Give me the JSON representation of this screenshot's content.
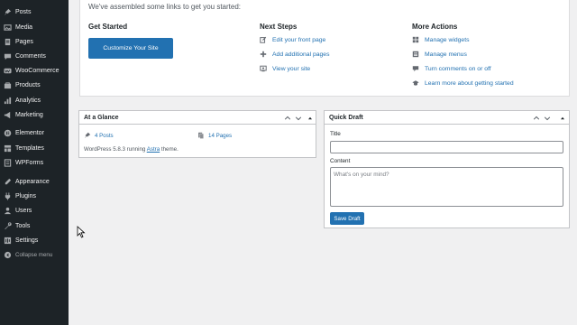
{
  "sidebar": {
    "items": [
      {
        "label": "Posts",
        "icon": "pushpin-icon"
      },
      {
        "label": "Media",
        "icon": "media-icon"
      },
      {
        "label": "Pages",
        "icon": "pages-icon"
      },
      {
        "label": "Comments",
        "icon": "comments-icon"
      },
      {
        "label": "WooCommerce",
        "icon": "woocommerce-icon"
      },
      {
        "label": "Products",
        "icon": "products-icon"
      },
      {
        "label": "Analytics",
        "icon": "analytics-icon"
      },
      {
        "label": "Marketing",
        "icon": "marketing-icon"
      },
      {
        "label": "Elementor",
        "icon": "elementor-icon"
      },
      {
        "label": "Templates",
        "icon": "templates-icon"
      },
      {
        "label": "WPForms",
        "icon": "wpforms-icon"
      },
      {
        "label": "Appearance",
        "icon": "appearance-icon"
      },
      {
        "label": "Plugins",
        "icon": "plugins-icon"
      },
      {
        "label": "Users",
        "icon": "users-icon"
      },
      {
        "label": "Tools",
        "icon": "tools-icon"
      },
      {
        "label": "Settings",
        "icon": "settings-icon"
      }
    ],
    "collapse_label": "Collapse menu"
  },
  "welcome": {
    "intro": "We've assembled some links to get you started:",
    "get_started": {
      "heading": "Get Started",
      "button": "Customize Your Site"
    },
    "next_steps": {
      "heading": "Next Steps",
      "links": [
        {
          "label": "Edit your front page",
          "icon": "edit-icon"
        },
        {
          "label": "Add additional pages",
          "icon": "plus-icon"
        },
        {
          "label": "View your site",
          "icon": "view-site-icon"
        }
      ]
    },
    "more_actions": {
      "heading": "More Actions",
      "links": [
        {
          "label": "Manage widgets",
          "icon": "widgets-icon"
        },
        {
          "label": "Manage menus",
          "icon": "menus-icon"
        },
        {
          "label": "Turn comments on or off",
          "icon": "comments-toggle-icon"
        },
        {
          "label": "Learn more about getting started",
          "icon": "learn-icon"
        }
      ]
    }
  },
  "at_a_glance": {
    "title": "At a Glance",
    "posts": "4 Posts",
    "pages": "14 Pages",
    "running_prefix": "WordPress 5.8.3 running ",
    "theme": "Astra",
    "running_suffix": " theme."
  },
  "quick_draft": {
    "title": "Quick Draft",
    "title_label": "Title",
    "title_value": "",
    "content_label": "Content",
    "content_placeholder": "What's on your mind?",
    "save_button": "Save Draft"
  },
  "colors": {
    "sidebar_bg": "#1d2327",
    "accent": "#2271b1",
    "page_bg": "#f0f0f1"
  }
}
